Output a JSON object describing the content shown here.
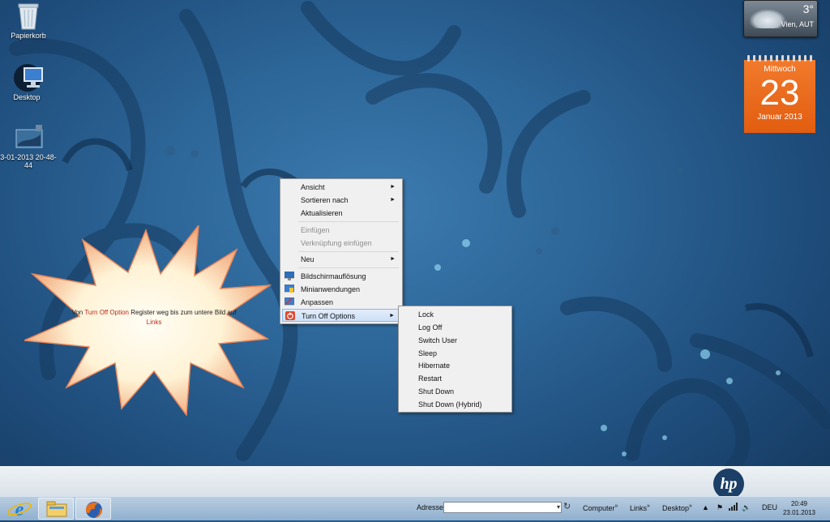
{
  "desktop": {
    "icons": [
      {
        "label": "Papierkorb",
        "icon": "recycle-bin-icon"
      },
      {
        "label": "Desktop",
        "icon": "computer-icon"
      },
      {
        "label": "3-01-2013 20-48-44",
        "icon": "screenshot-file-icon"
      }
    ]
  },
  "weather": {
    "temp": "3°",
    "location": "Vien, AUT"
  },
  "calendar": {
    "weekday": "Mittwoch",
    "day": "23",
    "month_year": "Januar 2013"
  },
  "note": {
    "prefix": "Von",
    "highlight": "Turn Off Option",
    "middle": "Register weg bis zum untere Bild auf",
    "link": "Links"
  },
  "context_menu": {
    "items": [
      {
        "label": "Ansicht",
        "submenu": true
      },
      {
        "label": "Sortieren nach",
        "submenu": true
      },
      {
        "label": "Aktualisieren"
      },
      {
        "label": "Einfügen",
        "disabled": true
      },
      {
        "label": "Verknüpfung einfügen",
        "disabled": true
      },
      {
        "label": "Neu",
        "submenu": true
      },
      {
        "label": "Bildschirmauflösung",
        "icon": "display-icon"
      },
      {
        "label": "Minianwendungen",
        "icon": "gadgets-icon"
      },
      {
        "label": "Anpassen",
        "icon": "personalize-icon"
      },
      {
        "label": "Turn Off Options",
        "icon": "power-icon",
        "submenu": true,
        "highlighted": true
      }
    ],
    "submenu_arrow": "►"
  },
  "turn_off_submenu": {
    "items": [
      "Lock",
      "Log Off",
      "Switch User",
      "Sleep",
      "Hibernate",
      "Restart",
      "Shut Down",
      "Shut Down (Hybrid)"
    ]
  },
  "taskbar": {
    "pinned": [
      {
        "name": "Internet Explorer",
        "icon": "internet-explorer-icon"
      },
      {
        "name": "Windows Explorer",
        "icon": "folder-icon"
      },
      {
        "name": "Firefox",
        "icon": "firefox-icon"
      }
    ],
    "address_label": "Adresse",
    "address_value": "",
    "toolbars": [
      "Computer",
      "Links",
      "Desktop"
    ],
    "chevron": "»",
    "language": "DEU",
    "time": "20:49",
    "date": "23.01.2013"
  },
  "brand": {
    "logo_text": "hp"
  },
  "colors": {
    "accent_orange": "#e8651a",
    "menu_highlight": "#cde0f7",
    "note_red": "#c0281a"
  }
}
